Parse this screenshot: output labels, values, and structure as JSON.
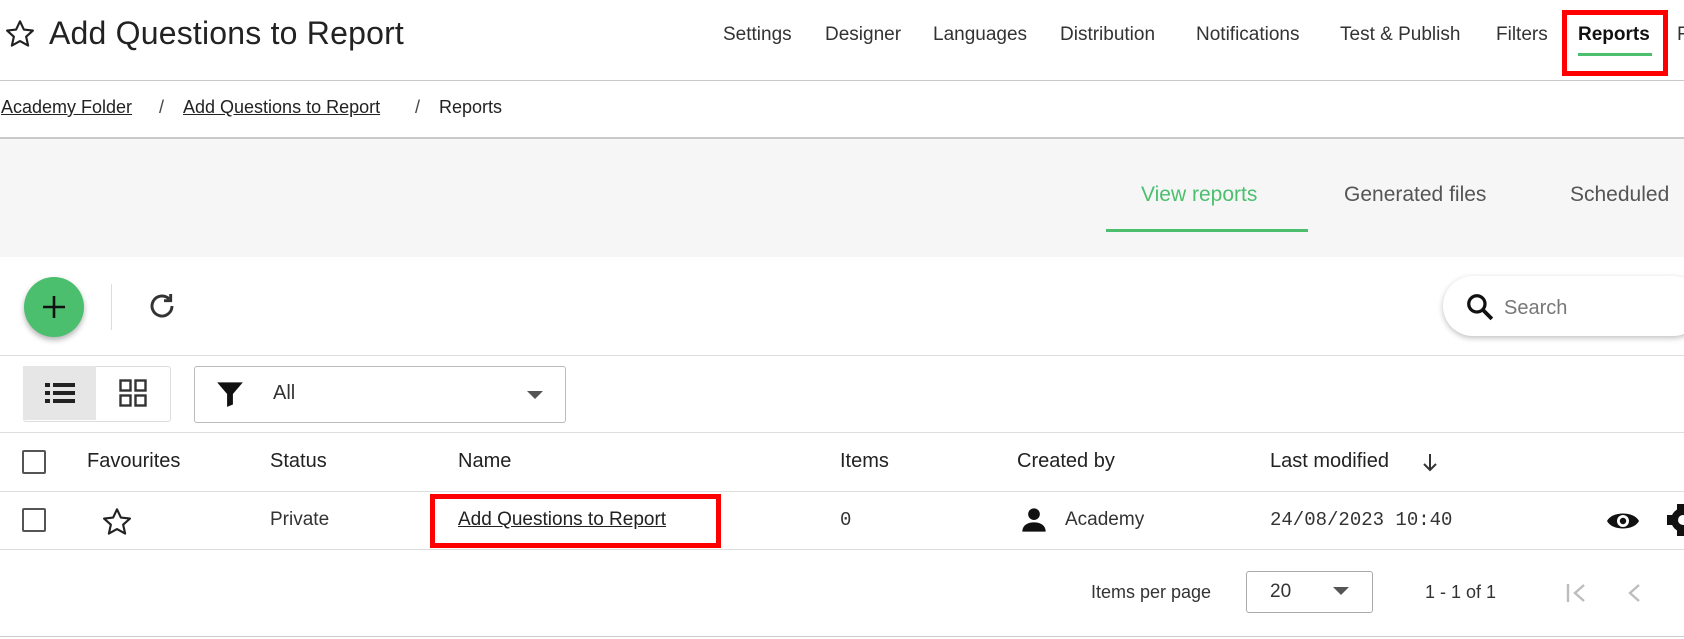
{
  "header": {
    "title": "Add Questions to Report",
    "nav": [
      "Settings",
      "Designer",
      "Languages",
      "Distribution",
      "Notifications",
      "Test & Publish",
      "Filters",
      "Reports",
      "R"
    ]
  },
  "breadcrumb": [
    "Academy Folder",
    "Add Questions to Report",
    "Reports"
  ],
  "tabs": [
    "View reports",
    "Generated files",
    "Scheduled"
  ],
  "search": {
    "placeholder": "Search"
  },
  "filter": {
    "value": "All"
  },
  "table": {
    "columns": [
      "Favourites",
      "Status",
      "Name",
      "Items",
      "Created by",
      "Last modified"
    ],
    "rows": [
      {
        "status": "Private",
        "name": "Add Questions to Report",
        "items": "0",
        "created_by": "Academy",
        "last_modified": "24/08/2023 10:40"
      }
    ]
  },
  "pagination": {
    "items_per_page_label": "Items per page",
    "page_size": "20",
    "range": "1 - 1 of 1"
  },
  "colors": {
    "accent": "#4cbf6f",
    "highlight": "#ff0000"
  }
}
